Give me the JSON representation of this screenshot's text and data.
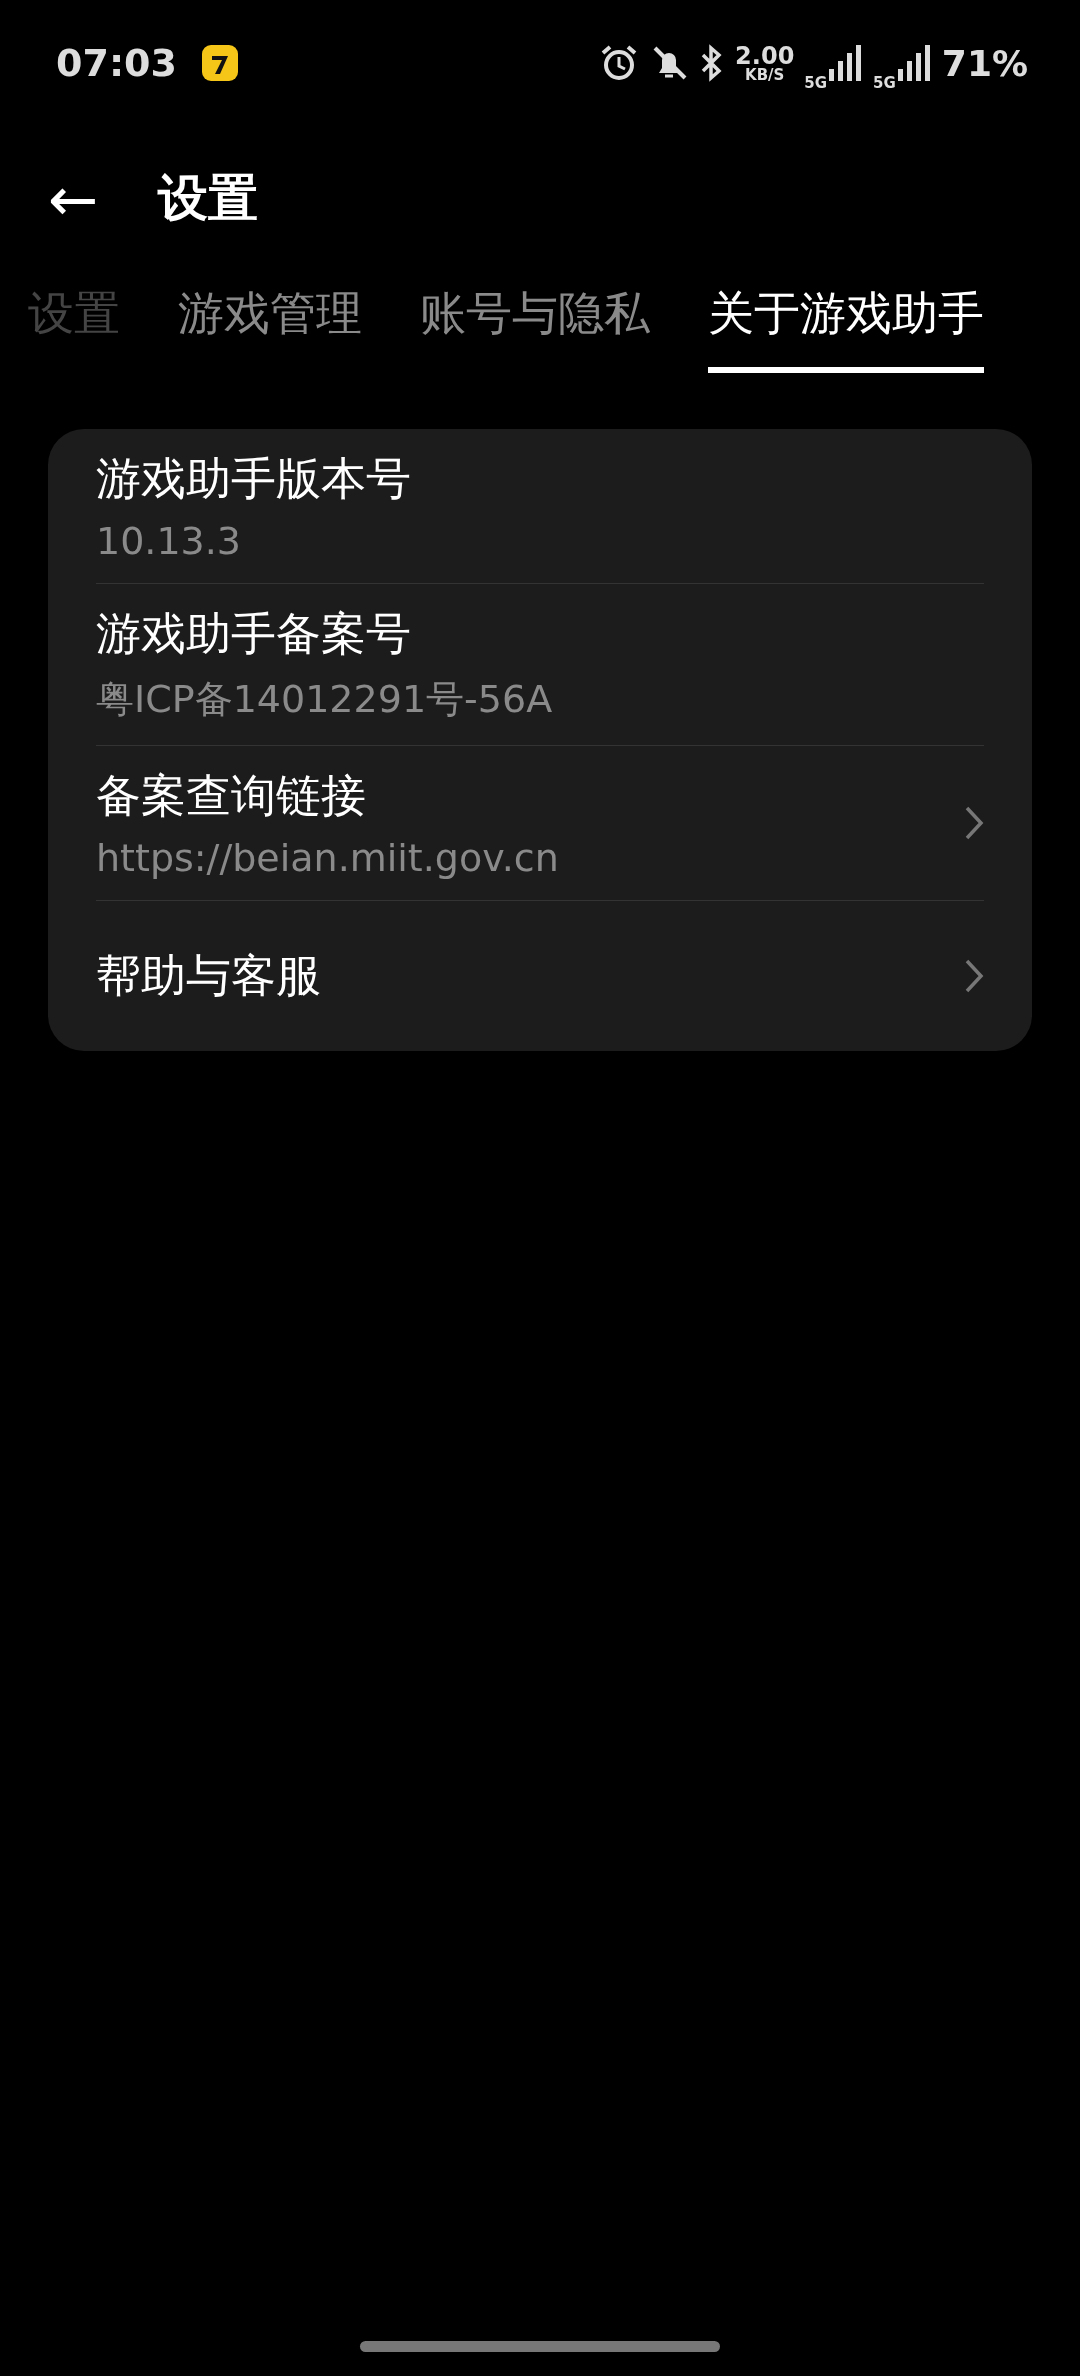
{
  "status_bar": {
    "time": "07:03",
    "speed_value": "2.00",
    "speed_unit": "KB/S",
    "sim1_label": "5G",
    "sim2_label": "5G",
    "battery": "71%"
  },
  "header": {
    "back_icon": "←",
    "title": "设置"
  },
  "tabs": [
    {
      "label": "设置",
      "selected": false,
      "faded": true
    },
    {
      "label": "游戏管理",
      "selected": false,
      "faded": false
    },
    {
      "label": "账号与隐私",
      "selected": false,
      "faded": false
    },
    {
      "label": "关于游戏助手",
      "selected": true,
      "faded": false
    }
  ],
  "items": [
    {
      "title": "游戏助手版本号",
      "value": "10.13.3",
      "chevron": false
    },
    {
      "title": "游戏助手备案号",
      "value": "粤ICP备14012291号-56A",
      "chevron": false
    },
    {
      "title": "备案查询链接",
      "value": "https://beian.miit.gov.cn",
      "chevron": true
    },
    {
      "title": "帮助与客服",
      "chevron": true
    }
  ]
}
